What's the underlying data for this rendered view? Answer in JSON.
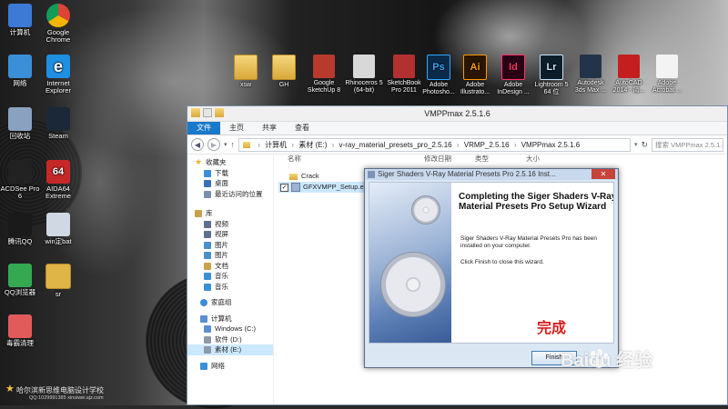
{
  "desktop": {
    "left_icons": [
      {
        "label": "计算机",
        "icon": "computer-icon",
        "color": "#3c7ad6"
      },
      {
        "label": "Google Chrome",
        "icon": "chrome-icon",
        "color": "#e8ba28"
      },
      {
        "label": "网络",
        "icon": "network-icon",
        "color": "#3b8fd8"
      },
      {
        "label": "Internet Explorer",
        "icon": "ie-icon",
        "color": "#1e8fe1"
      },
      {
        "label": "回收站",
        "icon": "recycle-bin-icon",
        "color": "#8aa2c0"
      },
      {
        "label": "Steam",
        "icon": "steam-icon",
        "color": "#1b2838"
      },
      {
        "label": "ACDSee Pro 6",
        "icon": "acdsee-icon",
        "color": "#222222"
      },
      {
        "label": "AIDA64 Extreme",
        "icon": "aida64-icon",
        "color": "#c62828"
      },
      {
        "label": "腾讯QQ",
        "icon": "qq-icon",
        "color": "#1a1a1a"
      },
      {
        "label": "win定bat",
        "icon": "bat-file-icon",
        "color": "#cfd8e3"
      },
      {
        "label": "QQ浏览器",
        "icon": "qq-browser-icon",
        "color": "#35a852"
      },
      {
        "label": "sr",
        "icon": "folder-icon",
        "color": "#e0b548"
      },
      {
        "label": "毒霸清理",
        "icon": "cleaner-icon",
        "color": "#e25b5b"
      }
    ],
    "top_icons": [
      {
        "label": "xsw",
        "icon": "folder-icon",
        "abbr": ""
      },
      {
        "label": "GH",
        "icon": "folder-icon",
        "abbr": ""
      },
      {
        "label": "Google SketchUp 8",
        "icon": "sketchup-icon",
        "abbr": ""
      },
      {
        "label": "Rhinoceros 5 (64-bit)",
        "icon": "rhino-icon",
        "abbr": ""
      },
      {
        "label": "SketchBook Pro 2011",
        "icon": "sketchbook-icon",
        "abbr": ""
      },
      {
        "label": "Adobe Photosho...",
        "icon": "photoshop-icon",
        "abbr": "Ps"
      },
      {
        "label": "Adobe Illustrato...",
        "icon": "illustrator-icon",
        "abbr": "Ai"
      },
      {
        "label": "Adobe InDesign ...",
        "icon": "indesign-icon",
        "abbr": "Id"
      },
      {
        "label": "Lightroom 5 64 位",
        "icon": "lightroom-icon",
        "abbr": "Lr"
      },
      {
        "label": "Autodesk 3ds Max ...",
        "icon": "3dsmax-icon",
        "abbr": ""
      },
      {
        "label": "AutoCAD 2014 - 简...",
        "icon": "autocad-icon",
        "abbr": ""
      },
      {
        "label": "Adobe Acrobat ...",
        "icon": "acrobat-icon",
        "abbr": ""
      }
    ],
    "bottom_text": "哈尔滨新思维电脑设计学校",
    "bottom_sub": "QQ:1029991385 xinsiwei.sjz.com",
    "watermark_logo": "Baidu 经验",
    "watermark_url": "jingyan.baidu.com"
  },
  "explorer": {
    "title": "VMPPmax 2.5.1.6",
    "tabs": [
      "文件",
      "主页",
      "共享",
      "查看"
    ],
    "address": [
      "计算机",
      "素材 (E:)",
      "v-ray_material_presets_pro_2.5.16",
      "VRMP_2.5.16",
      "VMPPmax 2.5.1.6"
    ],
    "search_placeholder": "搜索 VMPPmax 2.5.1.6",
    "nav": {
      "favorites": {
        "label": "收藏夹",
        "items": [
          "下载",
          "桌面",
          "最近访问的位置"
        ]
      },
      "libraries": {
        "label": "库",
        "items": [
          "视频",
          "视屏",
          "图片",
          "图片",
          "文档",
          "音乐",
          "音乐"
        ]
      },
      "homegroup": "家庭组",
      "computer": {
        "label": "计算机",
        "items": [
          "Windows (C:)",
          "软件 (D:)",
          "素材 (E:)"
        ]
      },
      "network": "网络"
    },
    "columns": [
      "名称",
      "修改日期",
      "类型",
      "大小"
    ],
    "files": [
      {
        "name": "Crack",
        "type": "folder"
      },
      {
        "name": "GFXVMPP_Setup.exe",
        "type": "exe",
        "checked": true
      }
    ]
  },
  "dialog": {
    "title": "Siger Shaders V-Ray Material Presets Pro 2.5.16 Inst...",
    "close_label": "✕",
    "heading": "Completing the Siger Shaders V-Ray Material Presets Pro Setup Wizard",
    "message1": "Siger Shaders V-Ray Material Presets Pro has been installed on your computer.",
    "message2": "Click Finish to close this wizard.",
    "annotation": "完成",
    "finish_label": "Finish"
  },
  "colors": {
    "file_tab": "#1979ca",
    "dialog_close": "#c7443a",
    "annotation": "#d81e1e"
  }
}
